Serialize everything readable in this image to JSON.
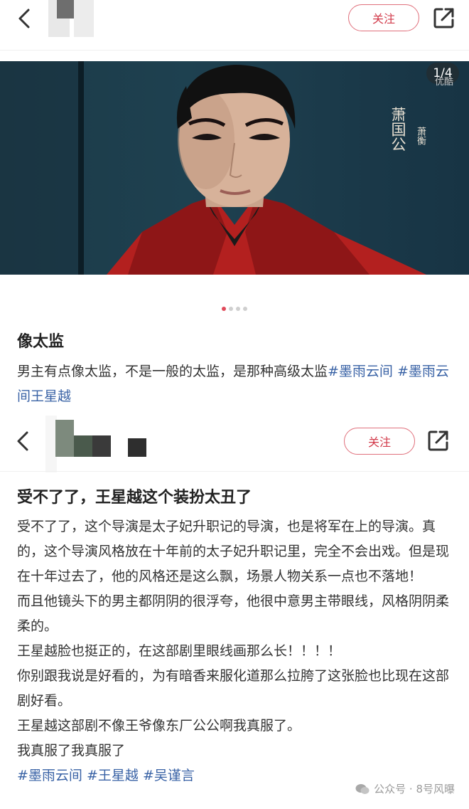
{
  "post1": {
    "follow_label": "关注",
    "image_counter": "1/4",
    "image_watermark": "优酷",
    "image_caption_main": "萧国公",
    "image_caption_sub": "萧衡",
    "title": "像太监",
    "body": "男主有点像太监，不是一般的太监，是那种高级太监",
    "tags": [
      "#墨雨云间",
      "#墨雨云间王星越"
    ]
  },
  "post2": {
    "follow_label": "关注",
    "title": "受不了了，王星越这个装扮太丑了",
    "paragraphs": [
      "受不了了，这个导演是太子妃升职记的导演，也是将军在上的导演。真的，这个导演风格放在十年前的太子妃升职记里，完全不会出戏。但是现在十年过去了，他的风格还是这么飘，场景人物关系一点也不落地！",
      "而且他镜头下的男主都阴阴的很浮夸，他很中意男主带眼线，风格阴阴柔柔的。",
      "王星越脸也挺正的，在这部剧里眼线画那么长！！！！",
      "你别跟我说是好看的，为有暗香来服化道那么拉胯了这张脸也比现在这部剧好看。",
      "王星越这部剧不像王爷像东厂公公啊我真服了。",
      "我真服了我真服了"
    ],
    "tags": [
      "#墨雨云间",
      "#王星越",
      "#吴谨言"
    ]
  },
  "footer_watermark": "公众号 · 8号风曝",
  "colors": {
    "accent": "#d23a4a",
    "tag": "#3a63a6"
  }
}
